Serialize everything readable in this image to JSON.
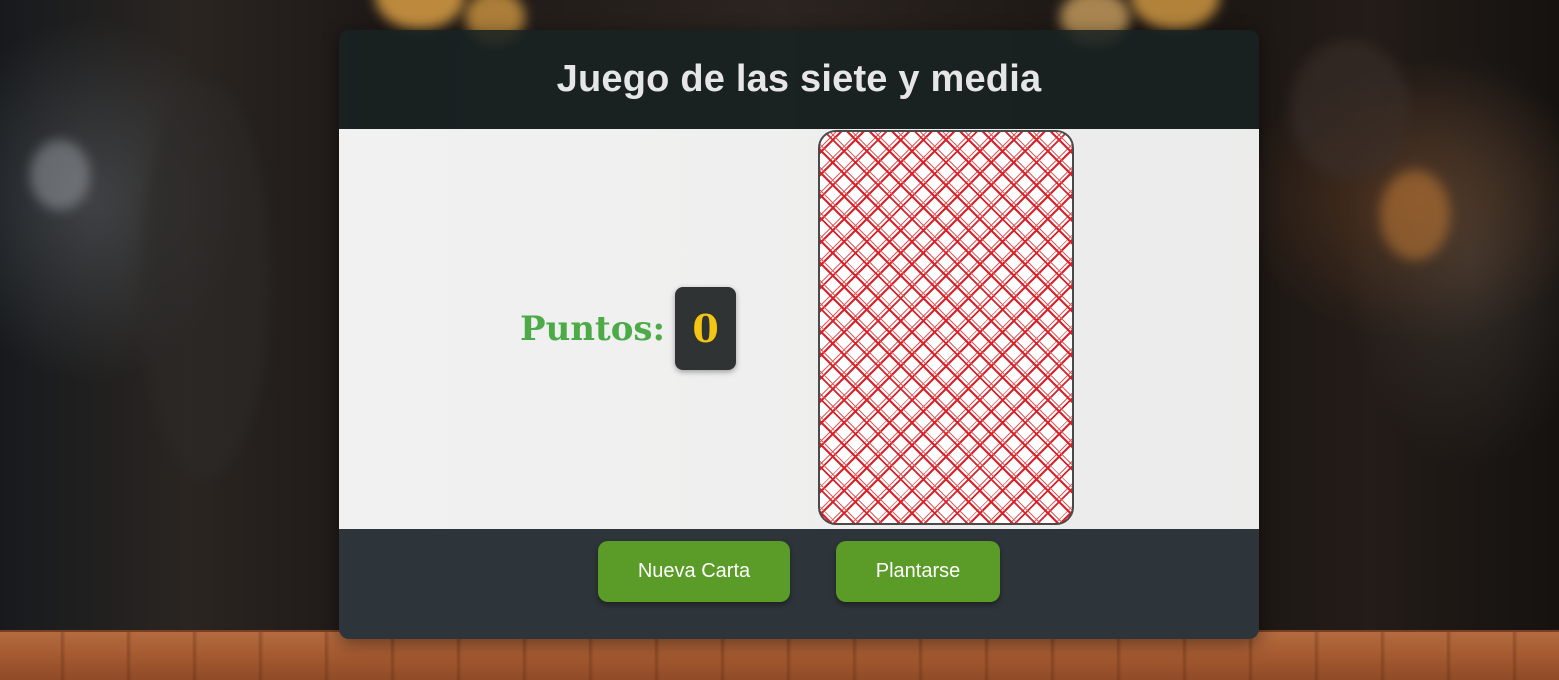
{
  "header": {
    "title": "Juego de las siete y media"
  },
  "board": {
    "score_label": "Puntos:",
    "score_value": "0",
    "card": "card-back"
  },
  "controls": {
    "new_card_label": "Nueva Carta",
    "stand_label": "Plantarse"
  },
  "colors": {
    "score_label": "#4caa47",
    "score_value": "#f4c512",
    "button": "#5a9c27",
    "card_pattern": "#d9232a"
  }
}
